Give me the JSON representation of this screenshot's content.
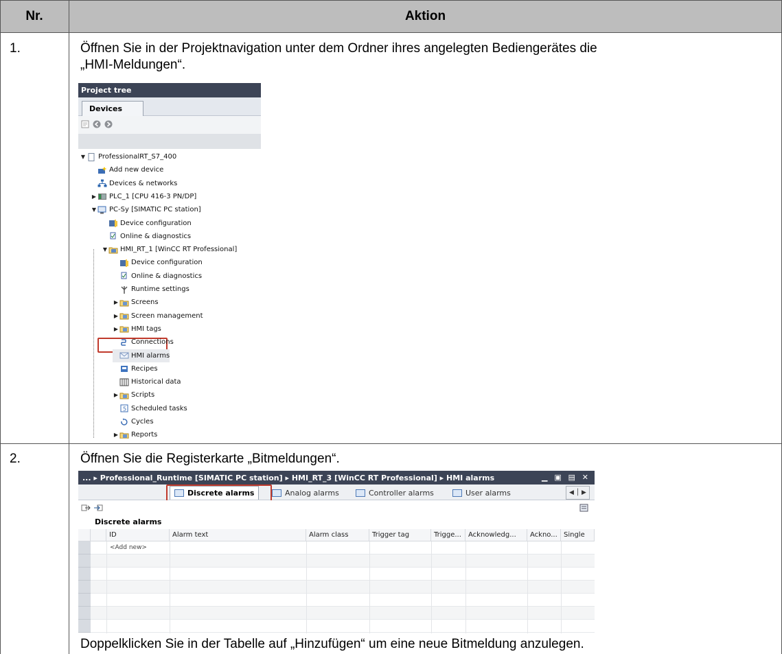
{
  "table": {
    "header": {
      "nr": "Nr.",
      "aktion": "Aktion"
    },
    "steps": [
      {
        "nr": "1.",
        "text_line1": "Öffnen Sie in der Projektnavigation unter dem Ordner ihres angelegten Bediengerätes die",
        "text_line2": "„HMI-Meldungen“."
      },
      {
        "nr": "2.",
        "text_line1": "Öffnen Sie die Registerkarte „Bitmeldungen“.",
        "text_after": "Doppelklicken Sie in der Tabelle auf „Hinzufügen“ um eine neue Bitmeldung anzulegen."
      }
    ]
  },
  "project_tree": {
    "title": "Project tree",
    "tab": "Devices",
    "items": [
      {
        "label": "ProfessionalRT_S7_400",
        "icon": "project-icon",
        "expanded": true
      },
      {
        "label": "Add new device",
        "icon": "add-device-icon"
      },
      {
        "label": "Devices & networks",
        "icon": "network-icon"
      },
      {
        "label": "PLC_1 [CPU 416-3 PN/DP]",
        "icon": "plc-icon",
        "expanded": false
      },
      {
        "label": "PC-Sy [SIMATIC PC station]",
        "icon": "pc-station-icon",
        "expanded": true
      },
      {
        "label": "Device configuration",
        "icon": "device-config-icon"
      },
      {
        "label": "Online & diagnostics",
        "icon": "diagnostics-icon"
      },
      {
        "label": "HMI_RT_1 [WinCC RT Professional]",
        "icon": "hmi-folder-icon",
        "expanded": true
      },
      {
        "label": "Device configuration",
        "icon": "device-config-icon"
      },
      {
        "label": "Online & diagnostics",
        "icon": "diagnostics-icon"
      },
      {
        "label": "Runtime settings",
        "icon": "runtime-settings-icon"
      },
      {
        "label": "Screens",
        "icon": "folder-icon",
        "expanded": false
      },
      {
        "label": "Screen management",
        "icon": "folder-icon",
        "expanded": false
      },
      {
        "label": "HMI tags",
        "icon": "folder-icon",
        "expanded": false
      },
      {
        "label": "Connections",
        "icon": "connections-icon"
      },
      {
        "label": "HMI alarms",
        "icon": "alarm-icon",
        "highlighted": true
      },
      {
        "label": "Recipes",
        "icon": "recipes-icon"
      },
      {
        "label": "Historical data",
        "icon": "historical-data-icon"
      },
      {
        "label": "Scripts",
        "icon": "folder-icon",
        "expanded": false
      },
      {
        "label": "Scheduled tasks",
        "icon": "scheduled-tasks-icon"
      },
      {
        "label": "Cycles",
        "icon": "cycles-icon"
      },
      {
        "label": "Reports",
        "icon": "folder-icon",
        "expanded": false
      }
    ]
  },
  "alarm_editor": {
    "breadcrumb": "... ▸ Professional_Runtime [SIMATIC PC station] ▸ HMI_RT_3 [WinCC RT Professional] ▸ HMI alarms",
    "tabs": [
      "Discrete alarms",
      "Analog alarms",
      "Controller alarms",
      "User alarms"
    ],
    "active_tab": "Discrete alarms",
    "section_title": "Discrete alarms",
    "columns": [
      "ID",
      "Alarm text",
      "Alarm class",
      "Trigger tag",
      "Trigge...",
      "Acknowledg...",
      "Ackno...",
      "Single"
    ],
    "add_new": "<Add new>",
    "accent": "#c0392b",
    "title_bar_color": "#3c4456"
  }
}
